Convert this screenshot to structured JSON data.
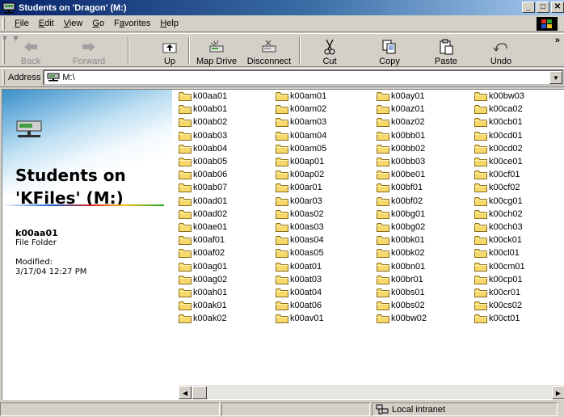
{
  "window": {
    "title": "Students on 'Dragon' (M:)",
    "minimize": "_",
    "maximize": "□",
    "close": "✕"
  },
  "menu": [
    {
      "label": "File",
      "key": "F",
      "rest": "ile"
    },
    {
      "label": "Edit",
      "key": "E",
      "rest": "dit"
    },
    {
      "label": "View",
      "key": "V",
      "rest": "iew"
    },
    {
      "label": "Go",
      "key": "G",
      "rest": "o"
    },
    {
      "label": "Favorites",
      "pre": "F",
      "key": "a",
      "rest": "vorites"
    },
    {
      "label": "Help",
      "key": "H",
      "rest": "elp"
    }
  ],
  "toolbar": {
    "back": "Back",
    "forward": "Forward",
    "up": "Up",
    "map_drive": "Map Drive",
    "disconnect": "Disconnect",
    "cut": "Cut",
    "copy": "Copy",
    "paste": "Paste",
    "undo": "Undo",
    "more": "»"
  },
  "address": {
    "label": "Address",
    "value": "M:\\"
  },
  "left_pane": {
    "title_line1": "Students on",
    "title_line2": "'KFiles' (M:)",
    "selected_name": "k00aa01",
    "selected_type": "File Folder",
    "modified_label": "Modified:",
    "modified_value": "3/17/04 12:27 PM"
  },
  "folders": [
    [
      "k00aa01",
      "k00ab01",
      "k00ab02",
      "k00ab03",
      "k00ab04",
      "k00ab05",
      "k00ab06",
      "k00ab07",
      "k00ad01",
      "k00ad02",
      "k00ae01",
      "k00af01",
      "k00af02",
      "k00ag01",
      "k00ag02",
      "k00ah01",
      "k00ak01",
      "k00ak02"
    ],
    [
      "k00am01",
      "k00am02",
      "k00am03",
      "k00am04",
      "k00am05",
      "k00ap01",
      "k00ap02",
      "k00ar01",
      "k00ar03",
      "k00as02",
      "k00as03",
      "k00as04",
      "k00as05",
      "k00at01",
      "k00at03",
      "k00at04",
      "k00at06",
      "k00av01"
    ],
    [
      "k00ay01",
      "k00az01",
      "k00az02",
      "k00bb01",
      "k00bb02",
      "k00bb03",
      "k00be01",
      "k00bf01",
      "k00bf02",
      "k00bg01",
      "k00bg02",
      "k00bk01",
      "k00bk02",
      "k00bn01",
      "k00br01",
      "k00bs01",
      "k00bs02",
      "k00bw02"
    ],
    [
      "k00bw03",
      "k00ca02",
      "k00cb01",
      "k00cd01",
      "k00cd02",
      "k00ce01",
      "k00cf01",
      "k00cf02",
      "k00cg01",
      "k00ch02",
      "k00ch03",
      "k00ck01",
      "k00cl01",
      "k00cm01",
      "k00cp01",
      "k00cr01",
      "k00cs02",
      "k00ct01"
    ]
  ],
  "status": {
    "zone": "Local intranet"
  }
}
